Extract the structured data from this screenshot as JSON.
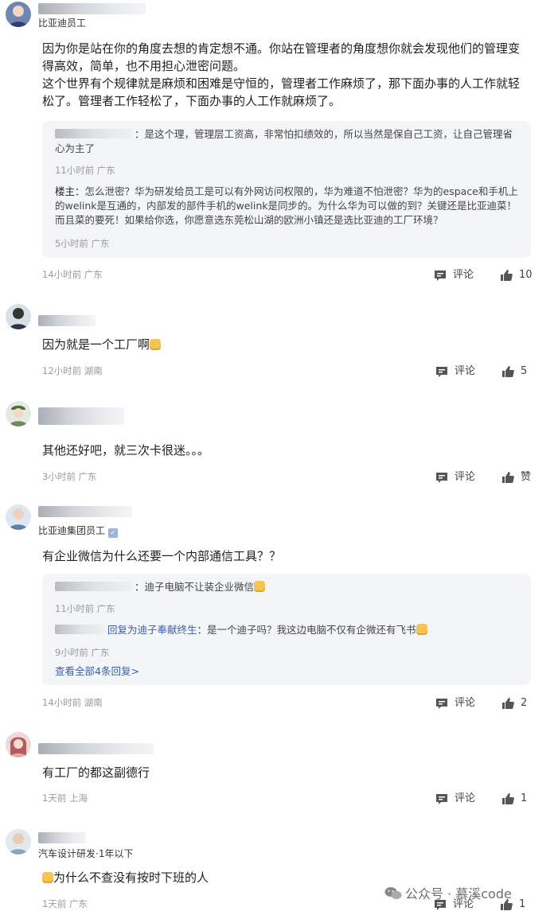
{
  "comments": [
    {
      "user_tag": "比亚迪员工",
      "text": "因为你是站在你的角度去想的肯定想不通。你站在管理者的角度想你就会发现他们的管理变得高效，简单，也不用担心泄密问题。\n这个世界有个规律就是麻烦和困难是守恒的，管理者工作麻烦了，那下面办事的人工作就轻松了。管理者工作轻松了，下面办事的人工作就麻烦了。",
      "replies": [
        {
          "text": "：是这个理，管理层工资高，非常怕扣绩效的，所以当然是保自己工资，让自己管理省心为主了",
          "meta": "11小时前 广东"
        },
        {
          "author": "楼主",
          "text": "：怎么泄密？华为研发给员工是可以有外网访问权限的，华为难道不怕泄密？华为的espace和手机上的welink是互通的，内部发的部件手机的welink是同步的。为什么华为可以做的到？关键还是比亚迪菜！而且菜的要死！如果给你选，你愿意选东莞松山湖的欧洲小镇还是选比亚迪的工厂环境？",
          "meta": "5小时前 广东"
        }
      ],
      "time": "14小时前 广东",
      "comment_label": "评论",
      "likes": "10"
    },
    {
      "text": "因为就是一个工厂啊",
      "time": "12小时前 湖南",
      "comment_label": "评论",
      "likes": "5"
    },
    {
      "text": "其他还好吧，就三次卡很迷。。。",
      "time": "3小时前 广东",
      "comment_label": "评论",
      "likes": "赞"
    },
    {
      "user_tag": "比亚迪集团员工",
      "text": "有企业微信为什么还要一个内部通信工具？？",
      "replies": [
        {
          "text": "：迪子电脑不让装企业微信",
          "meta": "11小时前 广东"
        },
        {
          "link": "回复为迪子奉献终生",
          "text": "：是一个迪子吗？我这边电脑不仅有企微还有飞书",
          "meta": "9小时前 广东"
        }
      ],
      "more_replies": "查看全部4条回复>",
      "time": "14小时前 湖南",
      "comment_label": "评论",
      "likes": "2"
    },
    {
      "text": "有工厂的都这副德行",
      "time": "1天前 上海",
      "comment_label": "评论",
      "likes": "1"
    },
    {
      "user_tag": "汽车设计研发·1年以下",
      "text": "为什么不查没有按时下班的人",
      "time": "1天前 广东",
      "comment_label": "评论",
      "likes": "1"
    }
  ],
  "watermark": "公众号 · 慕溪code",
  "icons": {
    "comment": "comment-icon",
    "like": "thumbs-up-icon",
    "watermark": "wechat-icon"
  },
  "colors": {
    "link": "#3a5fa8",
    "meta": "#9a9a9a",
    "reply_bg": "#f4f5f7"
  }
}
